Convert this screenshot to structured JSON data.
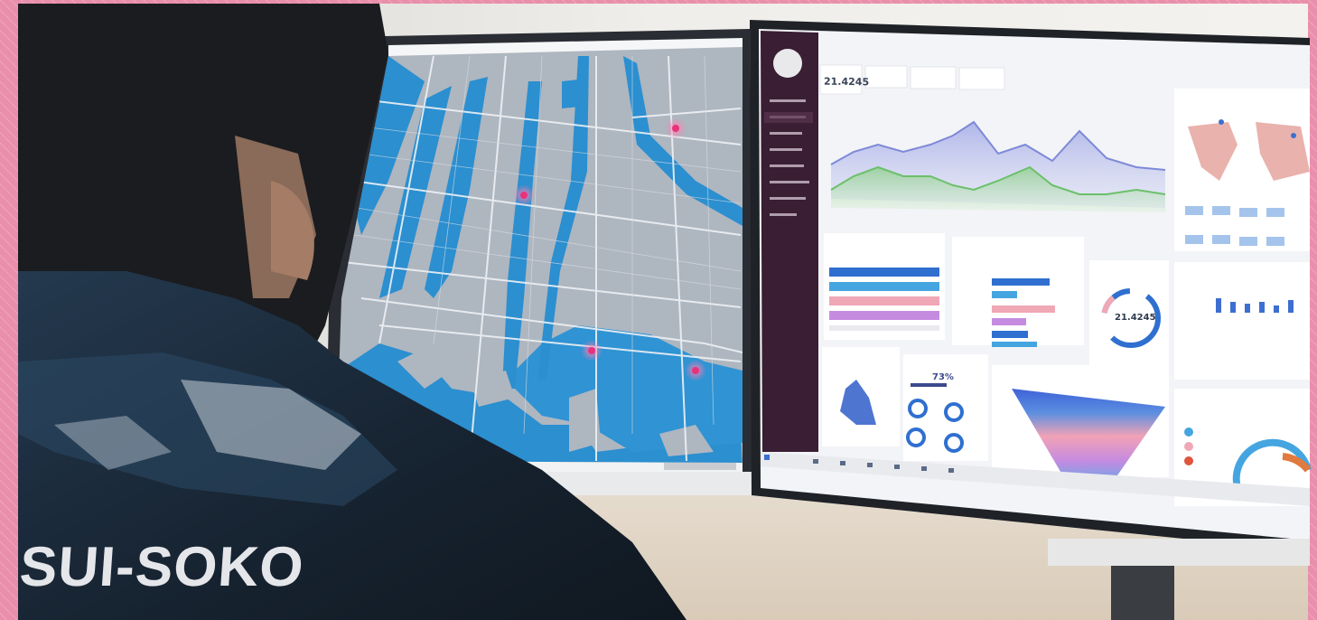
{
  "scene": {
    "jacket_text": "SUI-SOKO",
    "dashboard_kpi_value": "21.4245",
    "donut_center_value": "21.4245",
    "gauge_percent": "73%"
  },
  "colors": {
    "border_pink": "#e98fab",
    "water_blue": "#2b8fd0",
    "land_gray": "#b4bbc4",
    "pin_pink": "#e8327c",
    "sidebar_dark": "#3a1e33",
    "chart_blue": "#7e8ad8",
    "chart_green": "#6cc06a",
    "bar_blue": "#2f6fd0",
    "bar_pink": "#f0a7b6",
    "bar_purple": "#c58be0",
    "jacket_navy": "#1c2a3a"
  },
  "icons": [
    "map-pin-icon",
    "windows-start-icon",
    "taskbar-icon",
    "avatar-icon",
    "sidebar-menu-icon"
  ]
}
